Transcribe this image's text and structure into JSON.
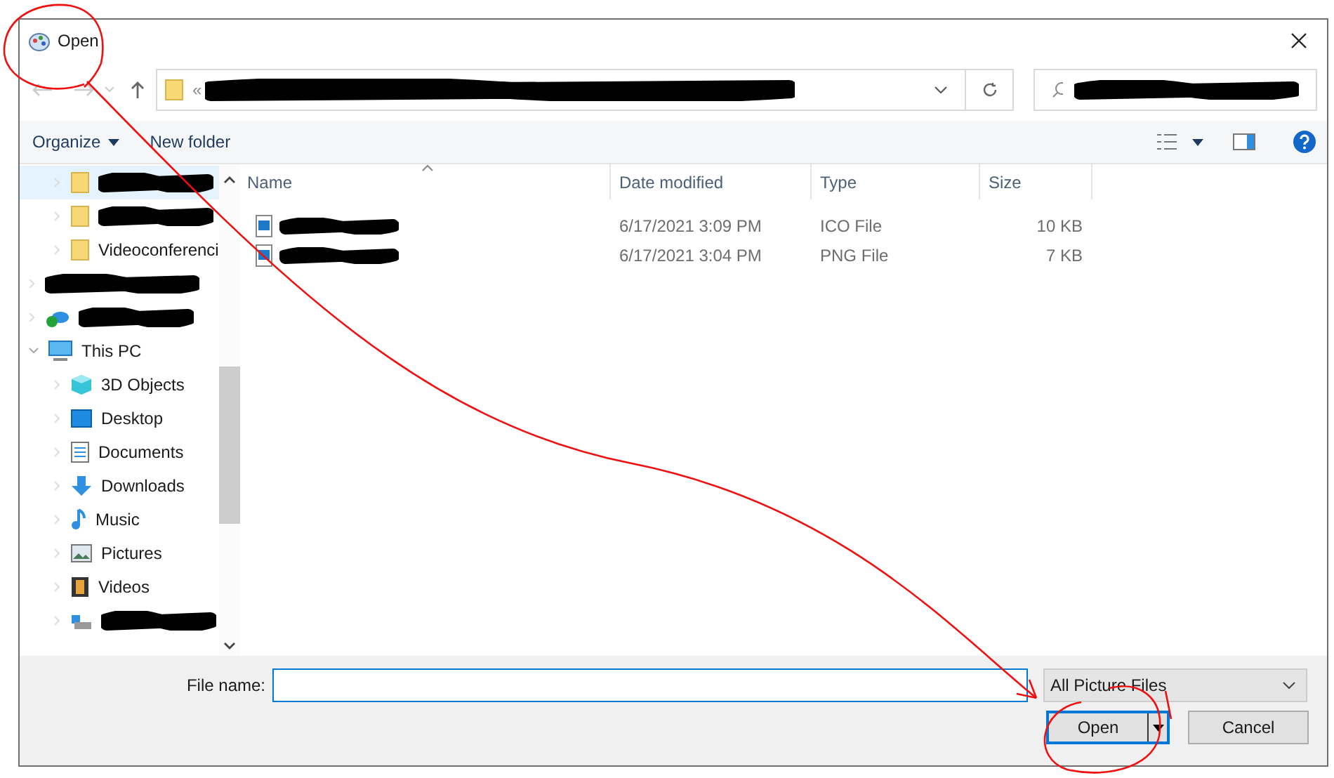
{
  "window": {
    "title": "Open"
  },
  "address": {
    "prefix": "«",
    "redacted": true
  },
  "search": {
    "redacted": true
  },
  "toolbar": {
    "organize": "Organize",
    "new_folder": "New folder"
  },
  "nav": [
    {
      "kind": "folder",
      "redacted": true,
      "selected": true,
      "expanded": false,
      "indent": true
    },
    {
      "kind": "folder",
      "redacted": true,
      "selected": false,
      "expanded": false,
      "indent": true
    },
    {
      "kind": "folder",
      "label": "Videoconferenci",
      "redacted": false,
      "selected": false,
      "expanded": false,
      "indent": true
    },
    {
      "kind": "blank",
      "redacted": true,
      "selected": false,
      "expanded": false,
      "indent": false
    },
    {
      "kind": "cloud",
      "redacted": true,
      "selected": false,
      "expanded": false,
      "indent": false
    },
    {
      "kind": "pc",
      "label": "This PC",
      "redacted": false,
      "selected": false,
      "expanded": true,
      "indent": false
    },
    {
      "kind": "cube",
      "label": "3D Objects",
      "redacted": false,
      "selected": false,
      "expanded": false,
      "indent": true
    },
    {
      "kind": "desktop",
      "label": "Desktop",
      "redacted": false,
      "selected": false,
      "expanded": false,
      "indent": true
    },
    {
      "kind": "document",
      "label": "Documents",
      "redacted": false,
      "selected": false,
      "expanded": false,
      "indent": true
    },
    {
      "kind": "download",
      "label": "Downloads",
      "redacted": false,
      "selected": false,
      "expanded": false,
      "indent": true
    },
    {
      "kind": "music",
      "label": "Music",
      "redacted": false,
      "selected": false,
      "expanded": false,
      "indent": true
    },
    {
      "kind": "picture",
      "label": "Pictures",
      "redacted": false,
      "selected": false,
      "expanded": false,
      "indent": true
    },
    {
      "kind": "video",
      "label": "Videos",
      "redacted": false,
      "selected": false,
      "expanded": false,
      "indent": true
    },
    {
      "kind": "drive",
      "redacted": true,
      "selected": false,
      "expanded": false,
      "indent": true
    }
  ],
  "columns": [
    "Name",
    "Date modified",
    "Type",
    "Size"
  ],
  "files": [
    {
      "name_redacted": true,
      "date": "6/17/2021 3:09 PM",
      "type": "ICO File",
      "size": "10 KB"
    },
    {
      "name_redacted": true,
      "date": "6/17/2021 3:04 PM",
      "type": "PNG File",
      "size": "7 KB"
    }
  ],
  "footer": {
    "file_name_label": "File name:",
    "filter": "All Picture Files",
    "open": "Open",
    "cancel": "Cancel"
  }
}
